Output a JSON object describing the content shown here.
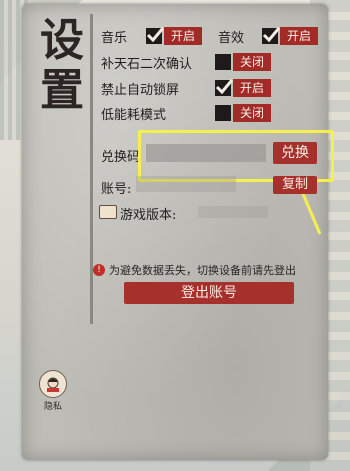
{
  "title": "设置",
  "settings": {
    "music": {
      "label": "音乐",
      "state": "开启"
    },
    "sound": {
      "label": "音效",
      "state": "开启"
    },
    "stone_confirm": {
      "label": "补天石二次确认",
      "state": "关闭"
    },
    "auto_lock": {
      "label": "禁止自动锁屏",
      "state": "开启"
    },
    "low_power": {
      "label": "低能耗模式",
      "state": "关闭"
    }
  },
  "redeem": {
    "label": "兑换码",
    "button": "兑换"
  },
  "account": {
    "label": "账号:",
    "button": "复制"
  },
  "version": {
    "label": "游戏版本:"
  },
  "warning": "为避免数据丢失，切换设备前请先登出",
  "logout_button": "登出账号",
  "privacy": "隐私",
  "colors": {
    "accent_red": "#a22a27",
    "highlight": "#f5f04a",
    "ink": "#221e1c"
  }
}
